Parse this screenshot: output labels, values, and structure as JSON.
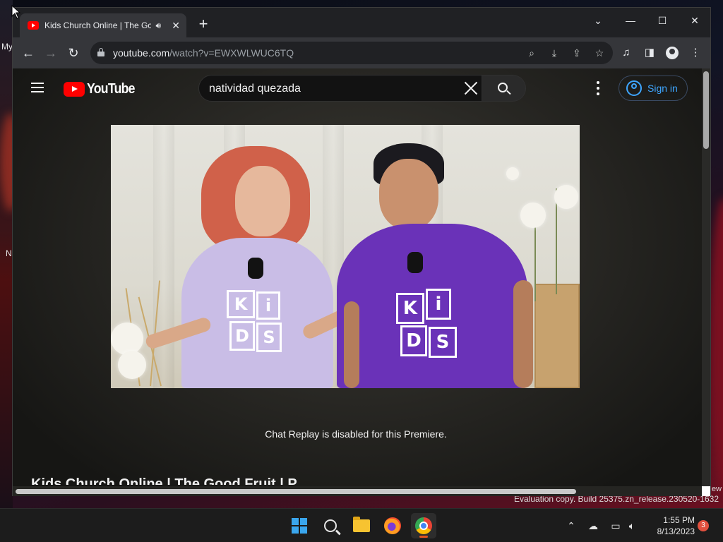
{
  "desktop": {
    "icon_labels": [
      "My",
      "N"
    ],
    "watermark": "Evaluation copy. Build 25375.zn_release.230520-1632",
    "right_fragment": "ew"
  },
  "browser": {
    "tab": {
      "title": "Kids Church Online | The Goo",
      "favicon": "youtube-icon",
      "audio": "speaker-icon",
      "close": "✕"
    },
    "new_tab": "+",
    "window_controls": {
      "menu": "⌄",
      "minimize": "—",
      "maximize": "☐",
      "close": "✕"
    },
    "nav": {
      "back": "←",
      "forward": "→",
      "reload": "↻"
    },
    "url": {
      "host": "youtube.com",
      "path": "/watch?v=EWXWLWUC6TQ"
    },
    "omnibox_icons": [
      "search-icon",
      "install-app-icon",
      "share-icon",
      "bookmark-star-icon"
    ],
    "toolbar_icons": [
      "media-control-icon",
      "side-panel-icon",
      "profile-icon",
      "more-menu-icon"
    ]
  },
  "youtube": {
    "logo_text": "YouTube",
    "search": {
      "value": "natividad quezada"
    },
    "signin_label": "Sign in",
    "chat_replay_message": "Chat Replay is disabled for this Premiere.",
    "video_title": "Kids Church Online | The Good Fruit | P",
    "shirt_letters": [
      "K",
      "i",
      "D",
      "S"
    ]
  },
  "taskbar": {
    "apps": [
      "start-icon",
      "search-icon",
      "file-explorer-icon",
      "firefox-icon",
      "chrome-icon"
    ],
    "tray_icons": [
      "chevron-up-icon",
      "cloud-off-icon",
      "display-network-icon",
      "volume-icon"
    ],
    "time": "1:55 PM",
    "date": "8/13/2023",
    "notification_count": "3"
  },
  "colors": {
    "youtube_red": "#ff0000",
    "link_blue": "#3ea6ff",
    "shirt_lavender": "#c9bde6",
    "shirt_purple": "#6a32b8"
  }
}
